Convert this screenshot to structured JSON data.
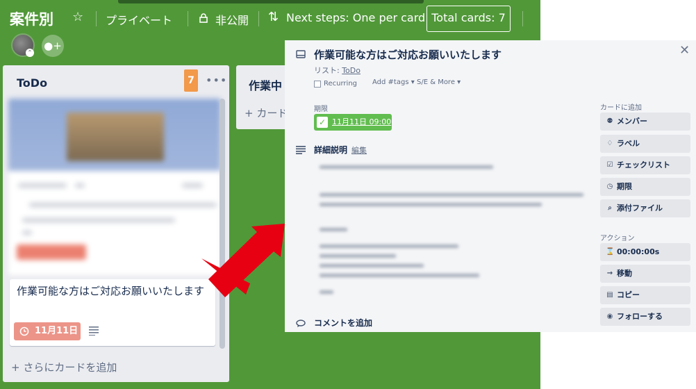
{
  "board": {
    "title": "案件別",
    "visibility_team": "プライベート",
    "visibility_public": "非公開",
    "powerup": "Next steps: One per card",
    "total_cards": "Total cards: 7",
    "background_color": "#519839"
  },
  "lists": {
    "todo": {
      "title": "ToDo",
      "count": "7",
      "card": {
        "title": "作業可能な方はご対応お願いいたします",
        "due": "11月11日",
        "due_color": "#ec9488"
      },
      "add_more": "+ さらにカードを追加"
    },
    "wip": {
      "title": "作業中",
      "add": "+ カード"
    }
  },
  "dialog": {
    "title": "作業可能な方はご対応お願いいたします",
    "list_prefix": "リスト: ",
    "list_name": "ToDo",
    "recurring": "Recurring",
    "add_tags": "Add #tags ▾",
    "se_more": "S/E & More ▾",
    "due_label": "期限",
    "due_value": "11月11日 09:00",
    "description_title": "詳細説明",
    "description_edit": "編集",
    "comment_title": "コメントを追加",
    "add_to_card_heading": "カードに追加",
    "add_to_card": [
      {
        "label": "メンバー",
        "icon": "member-icon"
      },
      {
        "label": "ラベル",
        "icon": "label-icon"
      },
      {
        "label": "チェックリスト",
        "icon": "checklist-icon"
      },
      {
        "label": "期限",
        "icon": "clock-icon"
      },
      {
        "label": "添付ファイル",
        "icon": "attachment-icon"
      }
    ],
    "actions_heading": "アクション",
    "actions": [
      {
        "label": "00:00:00s",
        "icon": "timer-icon"
      },
      {
        "label": "移動",
        "icon": "arrow-right-icon"
      },
      {
        "label": "コピー",
        "icon": "copy-icon"
      },
      {
        "label": "フォローする",
        "icon": "eye-icon"
      }
    ]
  }
}
